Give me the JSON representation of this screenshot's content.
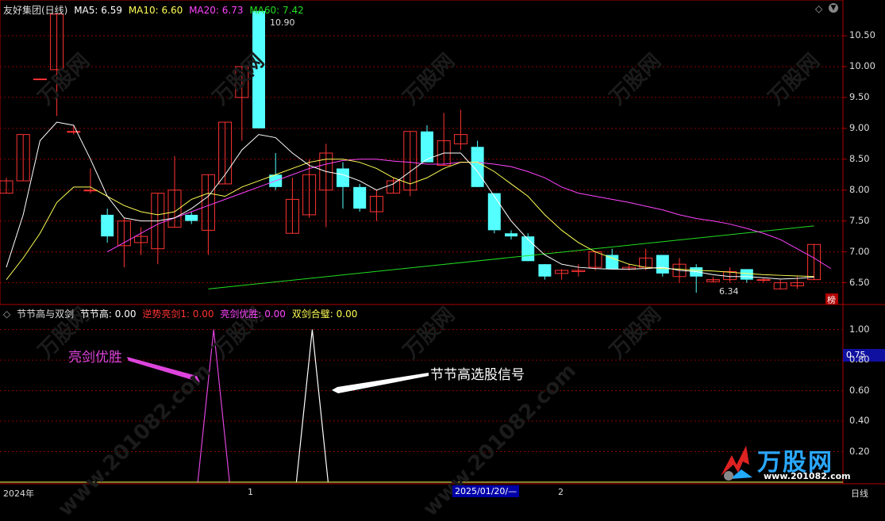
{
  "colors": {
    "up": "#ff3333",
    "down": "#54ffff",
    "ma5": "#ffffff",
    "ma10": "#ffff55",
    "ma20": "#ff44ff",
    "ma60": "#22dd22",
    "grid": "#8b0000",
    "border": "#b00000",
    "signal_magenta": "#dd44dd",
    "signal_white": "#ffffff"
  },
  "main_panel": {
    "title": "友好集团(日线)",
    "ma5_label": "MA5: 6.59",
    "ma10_label": "MA10: 6.60",
    "ma20_label": "MA20: 6.73",
    "ma60_label": "MA60: 7.42",
    "high_label": "10.90",
    "low_label": "6.34",
    "y_ticks": [
      "10.50",
      "10.00",
      "9.50",
      "9.00",
      "8.50",
      "8.00",
      "7.50",
      "7.00",
      "6.50"
    ],
    "corner_badge": "榜",
    "window_icons": [
      "diamond-icon",
      "down-arrow-icon"
    ]
  },
  "indicator_panel": {
    "name": "节节高与双剑",
    "fields": [
      {
        "label": "节节高: 0.00",
        "color": "#ffffff"
      },
      {
        "label": "逆势亮剑1: 0.00",
        "color": "#ff3333"
      },
      {
        "label": "亮剑优胜: 0.00",
        "color": "#ff44ff"
      },
      {
        "label": "双剑合璧: 0.00",
        "color": "#ffff55"
      }
    ],
    "y_ticks": [
      "1.00",
      "0.80",
      "0.60",
      "0.40",
      "0.20"
    ],
    "current_value": "0.75"
  },
  "annotations": {
    "left_text": "亮剑优胜",
    "right_text": "节节高选股信号"
  },
  "date_bar": {
    "year_label": "2024年",
    "month1": "1",
    "selected_date": "2025/01/20/—",
    "month2": "2",
    "period": "日线"
  },
  "watermark": {
    "brand": "万股网",
    "url": "www.201082.com",
    "logo_text": "万股网",
    "logo_url": "www.201082.com"
  },
  "chart_data": {
    "type": "candlestick",
    "ylim": [
      6.25,
      10.95
    ],
    "candles": [
      {
        "o": 7.95,
        "c": 8.15,
        "h": 8.2,
        "l": 7.95
      },
      {
        "o": 8.15,
        "c": 8.9,
        "h": 8.9,
        "l": 8.15
      },
      {
        "o": 9.8,
        "c": 9.8,
        "h": 9.8,
        "l": 9.8
      },
      {
        "o": 9.95,
        "c": 10.85,
        "h": 10.85,
        "l": 9.2
      },
      {
        "o": 8.95,
        "c": 8.95,
        "h": 9.05,
        "l": 8.9
      },
      {
        "o": 8.0,
        "c": 8.0,
        "h": 8.35,
        "l": 7.95
      },
      {
        "o": 7.6,
        "c": 7.25,
        "h": 7.7,
        "l": 7.15
      },
      {
        "o": 7.1,
        "c": 7.5,
        "h": 7.55,
        "l": 6.75
      },
      {
        "o": 7.15,
        "c": 7.25,
        "h": 7.4,
        "l": 6.95
      },
      {
        "o": 7.05,
        "c": 7.95,
        "h": 7.95,
        "l": 6.8
      },
      {
        "o": 7.4,
        "c": 8.0,
        "h": 8.55,
        "l": 7.4
      },
      {
        "o": 7.6,
        "c": 7.5,
        "h": 7.65,
        "l": 7.45
      },
      {
        "o": 7.35,
        "c": 8.25,
        "h": 8.25,
        "l": 6.95
      },
      {
        "o": 8.1,
        "c": 9.1,
        "h": 9.1,
        "l": 8.1
      },
      {
        "o": 9.5,
        "c": 10.0,
        "h": 10.0,
        "l": 8.8
      },
      {
        "o": 10.9,
        "c": 9.0,
        "h": 10.9,
        "l": 9.0
      },
      {
        "o": 8.25,
        "c": 8.05,
        "h": 8.6,
        "l": 8.0
      },
      {
        "o": 7.3,
        "c": 7.85,
        "h": 8.2,
        "l": 7.3
      },
      {
        "o": 7.6,
        "c": 8.25,
        "h": 8.5,
        "l": 7.55
      },
      {
        "o": 8.0,
        "c": 8.6,
        "h": 8.75,
        "l": 7.4
      },
      {
        "o": 8.35,
        "c": 8.05,
        "h": 8.45,
        "l": 7.7
      },
      {
        "o": 8.05,
        "c": 7.7,
        "h": 8.1,
        "l": 7.65
      },
      {
        "o": 7.65,
        "c": 7.9,
        "h": 8.0,
        "l": 7.5
      },
      {
        "o": 7.95,
        "c": 8.15,
        "h": 8.2,
        "l": 7.95
      },
      {
        "o": 8.0,
        "c": 8.95,
        "h": 8.95,
        "l": 7.9
      },
      {
        "o": 8.95,
        "c": 8.45,
        "h": 9.05,
        "l": 8.45
      },
      {
        "o": 8.4,
        "c": 8.8,
        "h": 9.25,
        "l": 8.4
      },
      {
        "o": 8.75,
        "c": 8.9,
        "h": 9.3,
        "l": 8.65
      },
      {
        "o": 8.7,
        "c": 8.05,
        "h": 8.8,
        "l": 8.05
      },
      {
        "o": 7.95,
        "c": 7.35,
        "h": 7.95,
        "l": 7.3
      },
      {
        "o": 7.3,
        "c": 7.25,
        "h": 7.35,
        "l": 7.2
      },
      {
        "o": 7.25,
        "c": 6.85,
        "h": 7.3,
        "l": 6.85
      },
      {
        "o": 6.8,
        "c": 6.6,
        "h": 6.8,
        "l": 6.55
      },
      {
        "o": 6.65,
        "c": 6.7,
        "h": 6.72,
        "l": 6.55
      },
      {
        "o": 6.68,
        "c": 6.7,
        "h": 6.8,
        "l": 6.6
      },
      {
        "o": 6.75,
        "c": 7.0,
        "h": 7.0,
        "l": 6.7
      },
      {
        "o": 6.95,
        "c": 6.72,
        "h": 7.05,
        "l": 6.72
      },
      {
        "o": 6.72,
        "c": 6.75,
        "h": 6.8,
        "l": 6.7
      },
      {
        "o": 6.75,
        "c": 6.9,
        "h": 7.05,
        "l": 6.7
      },
      {
        "o": 6.95,
        "c": 6.65,
        "h": 6.95,
        "l": 6.6
      },
      {
        "o": 6.6,
        "c": 6.8,
        "h": 6.9,
        "l": 6.5
      },
      {
        "o": 6.75,
        "c": 6.6,
        "h": 6.8,
        "l": 6.34
      },
      {
        "o": 6.52,
        "c": 6.55,
        "h": 6.6,
        "l": 6.5
      },
      {
        "o": 6.55,
        "c": 6.68,
        "h": 6.75,
        "l": 6.5
      },
      {
        "o": 6.72,
        "c": 6.55,
        "h": 6.72,
        "l": 6.5
      },
      {
        "o": 6.55,
        "c": 6.55,
        "h": 6.58,
        "l": 6.5
      },
      {
        "o": 6.4,
        "c": 6.5,
        "h": 6.55,
        "l": 6.4
      },
      {
        "o": 6.45,
        "c": 6.5,
        "h": 6.6,
        "l": 6.4
      },
      {
        "o": 6.55,
        "c": 7.12,
        "h": 7.12,
        "l": 6.55
      }
    ],
    "ma5": [
      6.75,
      7.6,
      8.8,
      9.1,
      9.05,
      8.5,
      7.9,
      7.55,
      7.5,
      7.5,
      7.55,
      7.7,
      7.9,
      8.25,
      8.65,
      8.9,
      8.85,
      8.6,
      8.4,
      8.3,
      8.25,
      8.15,
      8.0,
      8.1,
      8.3,
      8.5,
      8.6,
      8.6,
      8.3,
      7.9,
      7.5,
      7.2,
      6.95,
      6.8,
      6.75,
      6.73,
      6.72,
      6.72,
      6.73,
      6.75,
      6.7,
      6.68,
      6.63,
      6.6,
      6.6,
      6.58,
      6.56,
      6.57,
      6.59
    ],
    "ma10": [
      6.55,
      6.9,
      7.3,
      7.8,
      8.05,
      8.05,
      7.9,
      7.75,
      7.65,
      7.6,
      7.65,
      7.85,
      7.95,
      7.9,
      8.05,
      8.15,
      8.25,
      8.35,
      8.45,
      8.5,
      8.5,
      8.45,
      8.35,
      8.2,
      8.1,
      8.2,
      8.35,
      8.45,
      8.45,
      8.3,
      8.1,
      7.9,
      7.6,
      7.35,
      7.15,
      7.0,
      6.9,
      6.8,
      6.75,
      6.73,
      6.72,
      6.7,
      6.69,
      6.67,
      6.65,
      6.63,
      6.62,
      6.61,
      6.6
    ],
    "ma20": [
      null,
      null,
      null,
      null,
      null,
      null,
      7.0,
      7.15,
      7.3,
      7.45,
      7.55,
      7.65,
      7.75,
      7.85,
      7.95,
      8.05,
      8.15,
      8.25,
      8.35,
      8.42,
      8.48,
      8.5,
      8.5,
      8.47,
      8.45,
      8.42,
      8.42,
      8.45,
      8.45,
      8.42,
      8.38,
      8.3,
      8.2,
      8.05,
      7.95,
      7.9,
      7.85,
      7.8,
      7.74,
      7.68,
      7.6,
      7.54,
      7.5,
      7.45,
      7.38,
      7.3,
      7.2,
      7.05,
      6.9,
      6.73
    ],
    "ma60_start_index": 12,
    "ma60_start": 6.4,
    "ma60_end": 7.42
  },
  "indicator_chart_data": {
    "type": "line",
    "ylim": [
      0,
      1.05
    ],
    "signal_bars": [
      {
        "index": 11,
        "value": 1.0,
        "name": "亮剑优胜"
      },
      {
        "index": 17,
        "value": 1.0,
        "name": "节节高"
      }
    ]
  }
}
